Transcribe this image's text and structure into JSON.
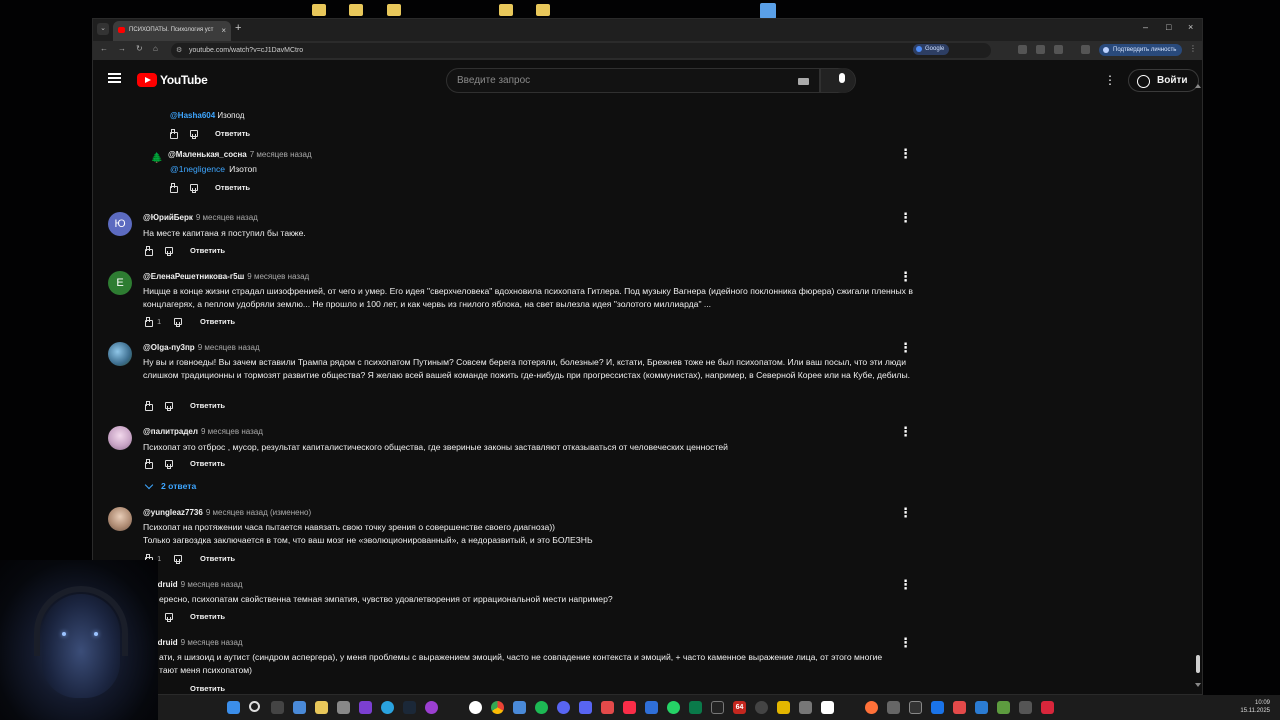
{
  "browser": {
    "tab_title": "ПСИХОПАТЫ. Психология уст",
    "tab_close": "×",
    "new_tab": "+",
    "tab_menu": "⌄",
    "url": "youtube.com/watch?v=cJ1DavMCtro",
    "google_pill": "Google",
    "confirm_identity": "Подтвердить личность",
    "window": {
      "minimize": "–",
      "maximize": "□",
      "close": "×"
    },
    "nav": {
      "back": "←",
      "forward": "→",
      "reload": "↻",
      "home": "⌂"
    }
  },
  "youtube": {
    "logo_text": "YouTube",
    "search_placeholder": "Введите запрос",
    "sign_in": "Войти",
    "more": "⋮"
  },
  "comments": [
    {
      "id": "c0",
      "partial": true,
      "author": "@Hasha604",
      "text": "Изопод",
      "reply": "Ответить"
    },
    {
      "id": "c1",
      "author": "@Маленькая_сосна",
      "time": "7 месяцев назад",
      "mention": "@1negligence",
      "text": "Изотоп",
      "reply": "Ответить",
      "avatar_letter": "🌲"
    },
    {
      "id": "c2",
      "author": "@ЮрийБерк",
      "time": "9 месяцев назад",
      "text": "На месте капитана я поступил бы также.",
      "reply": "Ответить",
      "avatar_letter": "Ю",
      "avatar_color": "#5c6bc0"
    },
    {
      "id": "c3",
      "author": "@ЕленаРешетникова-г5ш",
      "time": "9 месяцев назад",
      "text": "Ницще  в конце жизни страдал шизофренией, от чего и умер.  Его идея \"сверхчеловека\" вдохновила  психопата Гитлера. Под музыку Вагнера (идейного поклонника фюрера) сжигали пленных в концлагерях, а пеплом удобряли землю...  Не прошло и 100 лет, и как червь из гнилого яблока, на свет вылезла  идея \"золотого миллиарда\" ...",
      "likes": "1",
      "reply": "Ответить",
      "avatar_letter": "Е",
      "avatar_color": "#2e7d32"
    },
    {
      "id": "c4",
      "author": "@Olga-пу3пр",
      "time": "9 месяцев назад",
      "text": "Ну вы и говноеды! Вы зачем вставили Трампа рядом с психопатом Путиным? Совсем берега потеряли, болезные? И, кстати, Брежнев тоже не был психопатом. Или ваш посыл, что эти люди слишком традиционны и тормозят развитие общества? Я желаю всей вашей команде пожить где-нибудь при прогрессистах (коммунистах), например, в Северной Корее или на Кубе, дебилы.",
      "reply": "Ответить",
      "avatar_color": "#4a7fa8"
    },
    {
      "id": "c5",
      "author": "@палитрадел",
      "time": "9 месяцев назад",
      "text": "Психопат это отброс , мусор, результат капиталистического общества, где звериные законы заставляют отказываться от человеческих ценностей",
      "reply": "Ответить",
      "replies_toggle": "2 ответа",
      "avatar_color": "#c9a5c6"
    },
    {
      "id": "c6",
      "author": "@yungleaz7736",
      "time": "9 месяцев назад (изменено)",
      "text": "Психопат на протяжении часа пытается навязать свою точку зрения о совершенстве своего диагноза))",
      "text2": "Только загвоздка заключается в том, что ваш мозг не «эволюционированный», а недоразвитый, и это БОЛЕЗНЬ",
      "likes": "1",
      "reply": "Ответить",
      "avatar_color": "#b08d75"
    },
    {
      "id": "c7",
      "author": "@...tdruid",
      "author_visible": "tdruid",
      "time": "9 месяцев назад",
      "text": "ересно, психопатам свойственна темная эмпатия, чувство удовлетворения от иррациональной мести например?",
      "reply": "Ответить"
    },
    {
      "id": "c8",
      "author_visible": "tdruid",
      "time": "9 месяцев назад",
      "text": "ати, я шизоид и аутист (синдром аспергера), у меня проблемы с выражением эмоций, часто не совпадение контекста и эмоций, + часто каменное выражение лица, от этого многие",
      "text2": "тают меня психопатом)",
      "reply": "Ответить"
    }
  ],
  "taskbar": {
    "time": "10:09",
    "date": "15.11.2025",
    "badge": "64"
  },
  "colors": {
    "background": "#0f0f0f",
    "link_blue": "#3ea6ff",
    "youtube_red": "#ff0000"
  }
}
